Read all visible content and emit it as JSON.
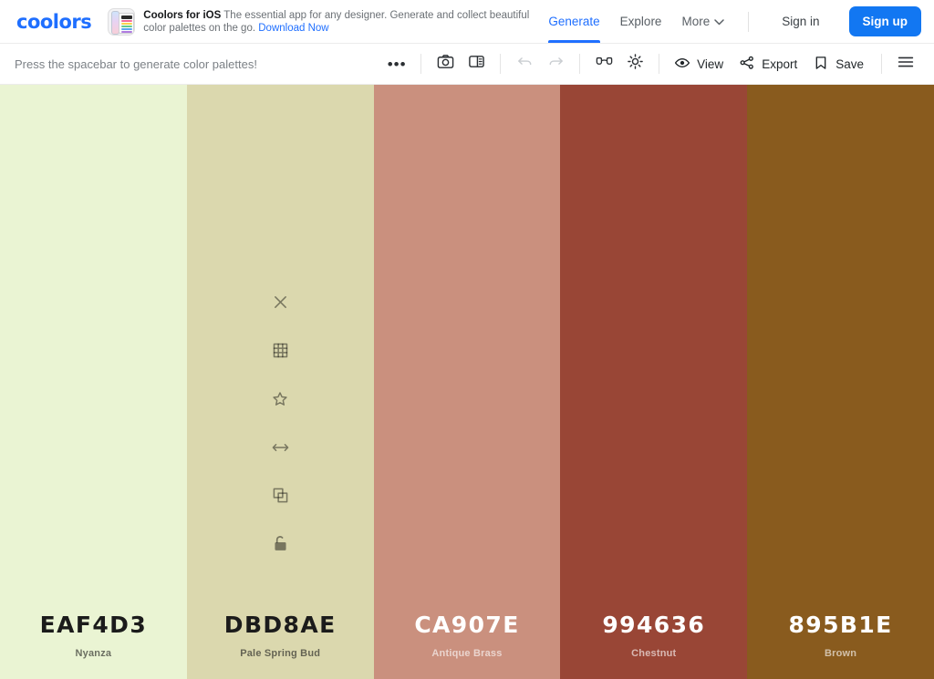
{
  "brand": {
    "logo": "coolors",
    "accent": "#1f6fff"
  },
  "promo": {
    "title": "Coolors for iOS",
    "description": "The essential app for any designer. Generate and collect beautiful color palettes on the go.",
    "cta": "Download Now",
    "icon": "ios-app-icon"
  },
  "nav": {
    "items": [
      {
        "label": "Generate",
        "active": true
      },
      {
        "label": "Explore",
        "active": false
      },
      {
        "label": "More",
        "active": false,
        "caret": true
      }
    ],
    "sign_in": "Sign in",
    "sign_up": "Sign up"
  },
  "toolbar": {
    "hint": "Press the spacebar to generate color palettes!",
    "more_label": "•••",
    "buttons": [
      {
        "name": "more-options-button",
        "icon": "ellipsis-icon",
        "disabled": false
      },
      {
        "name": "camera-button",
        "icon": "camera-icon",
        "disabled": false
      },
      {
        "name": "layout-button",
        "icon": "layout-panel-icon",
        "disabled": false
      },
      {
        "name": "undo-button",
        "icon": "undo-icon",
        "disabled": true
      },
      {
        "name": "redo-button",
        "icon": "redo-icon",
        "disabled": true
      },
      {
        "name": "color-blindness-button",
        "icon": "glasses-icon",
        "disabled": false
      },
      {
        "name": "adjust-button",
        "icon": "sun-icon",
        "disabled": false
      }
    ],
    "view_label": "View",
    "export_label": "Export",
    "save_label": "Save",
    "menu_label": "menu"
  },
  "swatch_actions": [
    {
      "name": "remove-color",
      "icon": "close-icon"
    },
    {
      "name": "view-shades",
      "icon": "grid-icon"
    },
    {
      "name": "favorite-color",
      "icon": "star-icon"
    },
    {
      "name": "drag-color",
      "icon": "drag-horizontal-icon"
    },
    {
      "name": "copy-color",
      "icon": "copy-icon"
    },
    {
      "name": "toggle-lock",
      "icon": "unlock-icon"
    }
  ],
  "palette": {
    "colors": [
      {
        "hex": "EAF4D3",
        "name": "Nyanza",
        "bg": "#EAF4D3",
        "text": "#1b1b1b",
        "hovered": false
      },
      {
        "hex": "DBD8AE",
        "name": "Pale Spring Bud",
        "bg": "#DBD8AE",
        "text": "#1b1b1b",
        "hovered": true
      },
      {
        "hex": "CA907E",
        "name": "Antique Brass",
        "bg": "#CA907E",
        "text": "#ffffff",
        "hovered": false
      },
      {
        "hex": "994636",
        "name": "Chestnut",
        "bg": "#994636",
        "text": "#ffffff",
        "hovered": false
      },
      {
        "hex": "895B1E",
        "name": "Brown",
        "bg": "#895B1E",
        "text": "#ffffff",
        "hovered": false
      }
    ]
  }
}
